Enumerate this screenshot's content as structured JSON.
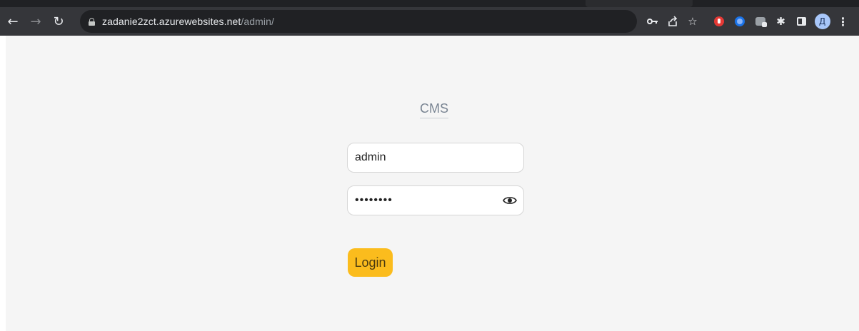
{
  "browser": {
    "url_host": "zadanie2zct.azurewebsites.net",
    "url_path": "/admin/",
    "profile_initial": "Д",
    "icons": {
      "back": "arrow-left-icon",
      "forward": "arrow-right-icon",
      "reload": "reload-icon",
      "lock": "lock-icon",
      "password_key": "key-icon",
      "share": "share-icon",
      "bookmark": "star-icon",
      "extensions": "puzzle-icon",
      "side_panel": "side-panel-icon",
      "menu": "kebab-menu-icon"
    }
  },
  "login": {
    "title": "CMS",
    "username_value": "admin",
    "password_value": "••••••••",
    "button_label": "Login",
    "button_color": "#fbbc1d"
  }
}
